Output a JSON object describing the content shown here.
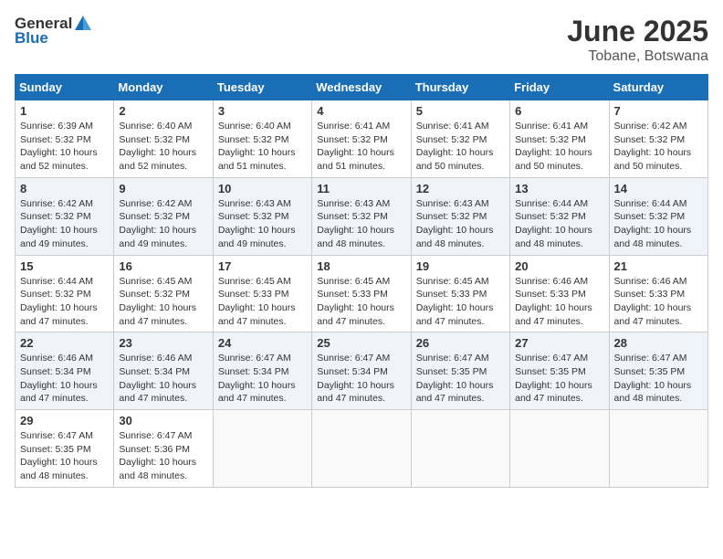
{
  "header": {
    "logo_general": "General",
    "logo_blue": "Blue",
    "month": "June 2025",
    "location": "Tobane, Botswana"
  },
  "days_of_week": [
    "Sunday",
    "Monday",
    "Tuesday",
    "Wednesday",
    "Thursday",
    "Friday",
    "Saturday"
  ],
  "weeks": [
    [
      {
        "day": "1",
        "info": "Sunrise: 6:39 AM\nSunset: 5:32 PM\nDaylight: 10 hours\nand 52 minutes."
      },
      {
        "day": "2",
        "info": "Sunrise: 6:40 AM\nSunset: 5:32 PM\nDaylight: 10 hours\nand 52 minutes."
      },
      {
        "day": "3",
        "info": "Sunrise: 6:40 AM\nSunset: 5:32 PM\nDaylight: 10 hours\nand 51 minutes."
      },
      {
        "day": "4",
        "info": "Sunrise: 6:41 AM\nSunset: 5:32 PM\nDaylight: 10 hours\nand 51 minutes."
      },
      {
        "day": "5",
        "info": "Sunrise: 6:41 AM\nSunset: 5:32 PM\nDaylight: 10 hours\nand 50 minutes."
      },
      {
        "day": "6",
        "info": "Sunrise: 6:41 AM\nSunset: 5:32 PM\nDaylight: 10 hours\nand 50 minutes."
      },
      {
        "day": "7",
        "info": "Sunrise: 6:42 AM\nSunset: 5:32 PM\nDaylight: 10 hours\nand 50 minutes."
      }
    ],
    [
      {
        "day": "8",
        "info": "Sunrise: 6:42 AM\nSunset: 5:32 PM\nDaylight: 10 hours\nand 49 minutes."
      },
      {
        "day": "9",
        "info": "Sunrise: 6:42 AM\nSunset: 5:32 PM\nDaylight: 10 hours\nand 49 minutes."
      },
      {
        "day": "10",
        "info": "Sunrise: 6:43 AM\nSunset: 5:32 PM\nDaylight: 10 hours\nand 49 minutes."
      },
      {
        "day": "11",
        "info": "Sunrise: 6:43 AM\nSunset: 5:32 PM\nDaylight: 10 hours\nand 48 minutes."
      },
      {
        "day": "12",
        "info": "Sunrise: 6:43 AM\nSunset: 5:32 PM\nDaylight: 10 hours\nand 48 minutes."
      },
      {
        "day": "13",
        "info": "Sunrise: 6:44 AM\nSunset: 5:32 PM\nDaylight: 10 hours\nand 48 minutes."
      },
      {
        "day": "14",
        "info": "Sunrise: 6:44 AM\nSunset: 5:32 PM\nDaylight: 10 hours\nand 48 minutes."
      }
    ],
    [
      {
        "day": "15",
        "info": "Sunrise: 6:44 AM\nSunset: 5:32 PM\nDaylight: 10 hours\nand 47 minutes."
      },
      {
        "day": "16",
        "info": "Sunrise: 6:45 AM\nSunset: 5:32 PM\nDaylight: 10 hours\nand 47 minutes."
      },
      {
        "day": "17",
        "info": "Sunrise: 6:45 AM\nSunset: 5:33 PM\nDaylight: 10 hours\nand 47 minutes."
      },
      {
        "day": "18",
        "info": "Sunrise: 6:45 AM\nSunset: 5:33 PM\nDaylight: 10 hours\nand 47 minutes."
      },
      {
        "day": "19",
        "info": "Sunrise: 6:45 AM\nSunset: 5:33 PM\nDaylight: 10 hours\nand 47 minutes."
      },
      {
        "day": "20",
        "info": "Sunrise: 6:46 AM\nSunset: 5:33 PM\nDaylight: 10 hours\nand 47 minutes."
      },
      {
        "day": "21",
        "info": "Sunrise: 6:46 AM\nSunset: 5:33 PM\nDaylight: 10 hours\nand 47 minutes."
      }
    ],
    [
      {
        "day": "22",
        "info": "Sunrise: 6:46 AM\nSunset: 5:34 PM\nDaylight: 10 hours\nand 47 minutes."
      },
      {
        "day": "23",
        "info": "Sunrise: 6:46 AM\nSunset: 5:34 PM\nDaylight: 10 hours\nand 47 minutes."
      },
      {
        "day": "24",
        "info": "Sunrise: 6:47 AM\nSunset: 5:34 PM\nDaylight: 10 hours\nand 47 minutes."
      },
      {
        "day": "25",
        "info": "Sunrise: 6:47 AM\nSunset: 5:34 PM\nDaylight: 10 hours\nand 47 minutes."
      },
      {
        "day": "26",
        "info": "Sunrise: 6:47 AM\nSunset: 5:35 PM\nDaylight: 10 hours\nand 47 minutes."
      },
      {
        "day": "27",
        "info": "Sunrise: 6:47 AM\nSunset: 5:35 PM\nDaylight: 10 hours\nand 47 minutes."
      },
      {
        "day": "28",
        "info": "Sunrise: 6:47 AM\nSunset: 5:35 PM\nDaylight: 10 hours\nand 48 minutes."
      }
    ],
    [
      {
        "day": "29",
        "info": "Sunrise: 6:47 AM\nSunset: 5:35 PM\nDaylight: 10 hours\nand 48 minutes."
      },
      {
        "day": "30",
        "info": "Sunrise: 6:47 AM\nSunset: 5:36 PM\nDaylight: 10 hours\nand 48 minutes."
      },
      {
        "day": "",
        "info": ""
      },
      {
        "day": "",
        "info": ""
      },
      {
        "day": "",
        "info": ""
      },
      {
        "day": "",
        "info": ""
      },
      {
        "day": "",
        "info": ""
      }
    ]
  ]
}
